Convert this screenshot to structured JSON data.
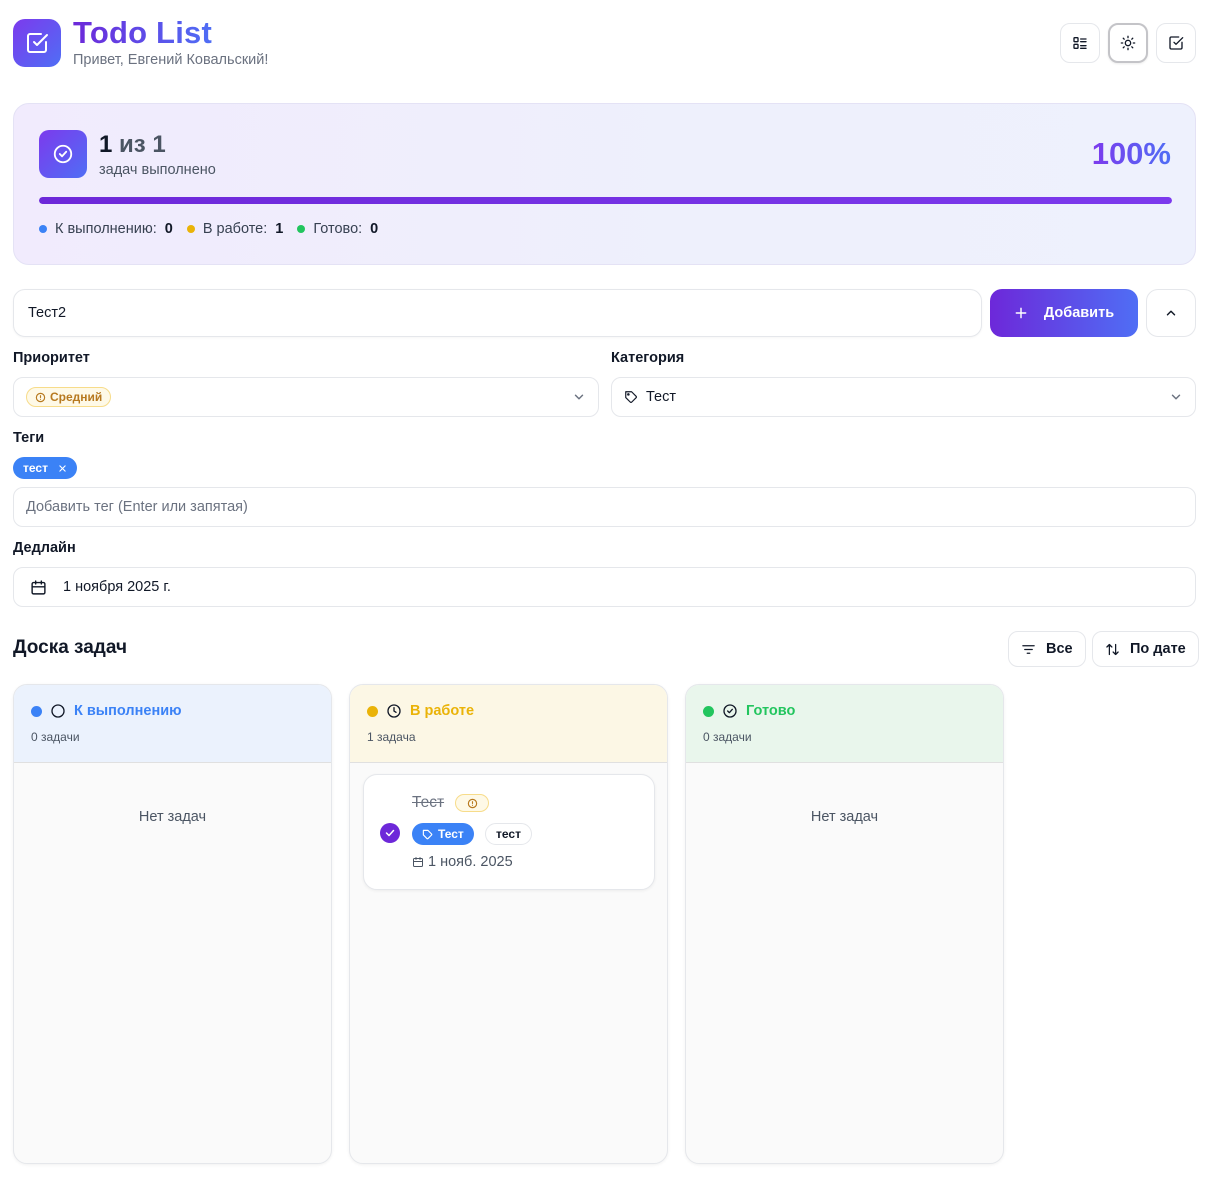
{
  "header": {
    "title": "Todo List",
    "greeting": "Привет, Евгений Ковальский!"
  },
  "progress": {
    "done": "1",
    "of_label": "из",
    "total": "1",
    "subtitle": "задач выполнено",
    "percent_label": "100%",
    "percent_value": 100,
    "stats": [
      {
        "label": "К выполнению:",
        "value": "0",
        "color": "#3b82f6"
      },
      {
        "label": "В работе:",
        "value": "1",
        "color": "#eab308"
      },
      {
        "label": "Готово:",
        "value": "0",
        "color": "#22c55e"
      }
    ]
  },
  "form": {
    "title_value": "Тест2",
    "add_label": "Добавить",
    "priority_label": "Приоритет",
    "priority_value": "Средний",
    "category_label": "Категория",
    "category_value": "Тест",
    "tags_label": "Теги",
    "tags": [
      "тест"
    ],
    "tag_placeholder": "Добавить тег (Enter или запятая)",
    "deadline_label": "Дедлайн",
    "deadline_value": "1 ноября 2025 г."
  },
  "board": {
    "title": "Доска задач",
    "filter_label": "Все",
    "sort_label": "По дате",
    "columns": [
      {
        "title": "К выполнению",
        "count": "0 задачи",
        "color": "#3b82f6",
        "bg": "#ebf2fd",
        "empty": "Нет задач"
      },
      {
        "title": "В работе",
        "count": "1 задача",
        "color": "#eab308",
        "bg": "#fcf7e5",
        "empty": ""
      },
      {
        "title": "Готово",
        "count": "0 задачи",
        "color": "#22c55e",
        "bg": "#e9f6ec",
        "empty": "Нет задач"
      }
    ],
    "task": {
      "title": "Тест",
      "category": "Тест",
      "tag": "тест",
      "date": "1 нояб. 2025"
    }
  },
  "icons": {
    "logo": "check-square-icon",
    "view": "list-icon",
    "theme": "sun-icon",
    "tasks": "check-square-icon",
    "calendar": "calendar-icon",
    "tag": "tag-icon"
  },
  "colors": {
    "accent": "#6d28d9",
    "accent2": "#4f6ef5"
  }
}
